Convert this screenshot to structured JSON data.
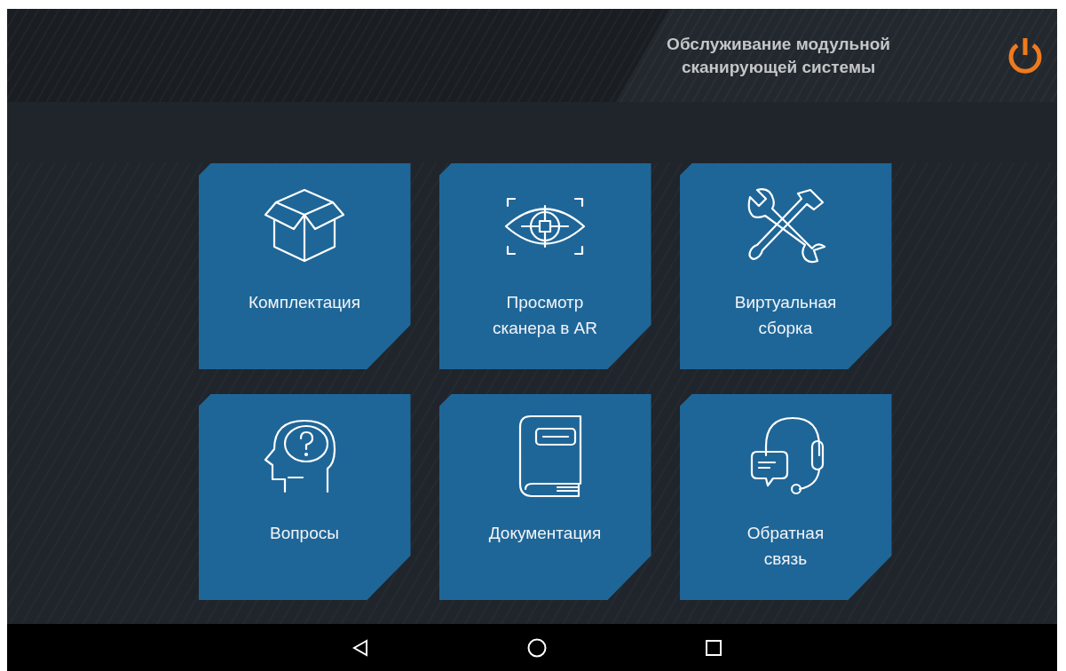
{
  "header": {
    "title_lines": [
      "Обслуживание модульной",
      "сканирующей системы"
    ]
  },
  "tiles": [
    {
      "lines": [
        "Комплектация"
      ]
    },
    {
      "lines": [
        "Просмотр",
        "сканера в AR"
      ]
    },
    {
      "lines": [
        "Виртуальная",
        "сборка"
      ]
    },
    {
      "lines": [
        "Вопросы"
      ]
    },
    {
      "lines": [
        "Документация"
      ]
    },
    {
      "lines": [
        "Обратная",
        "связь"
      ]
    }
  ]
}
